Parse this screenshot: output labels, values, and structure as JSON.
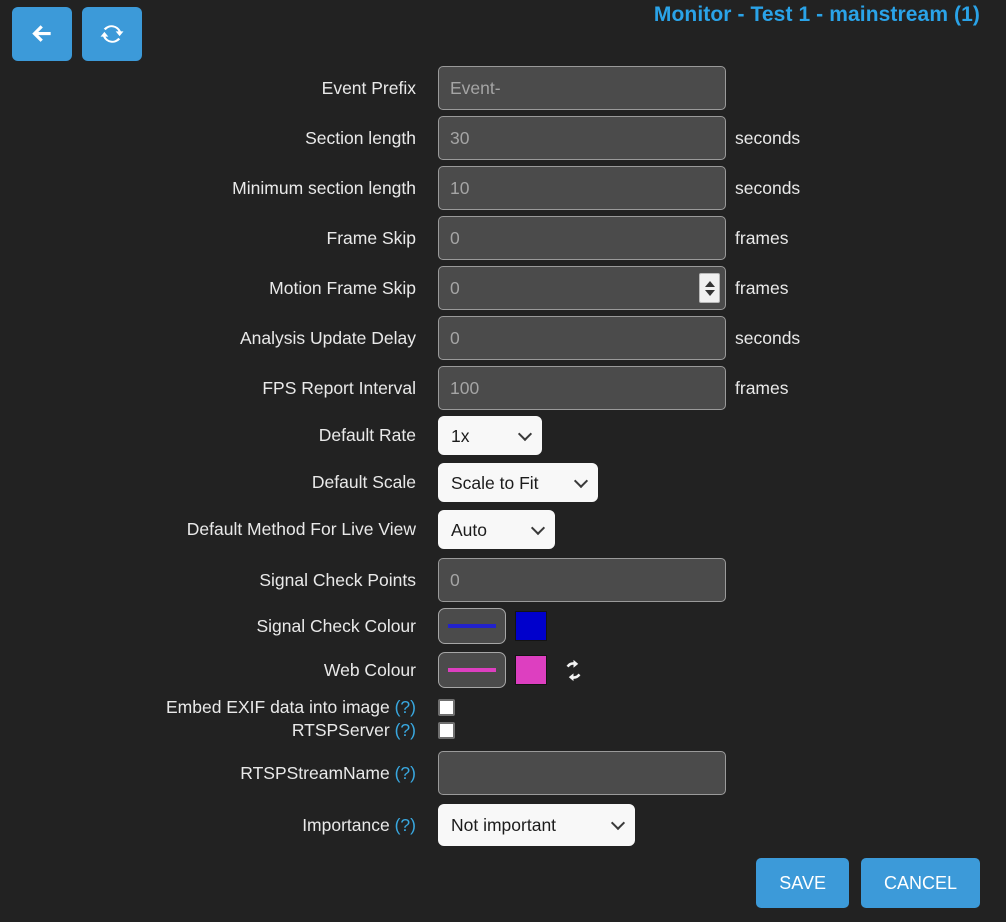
{
  "header": {
    "title": "Monitor - Test 1 - mainstream (1)",
    "back_icon": "arrow-left-icon",
    "refresh_icon": "refresh-icon",
    "accent_color": "#2aa3e8",
    "button_color": "#3c9ad9"
  },
  "fields": {
    "event_prefix": {
      "label": "Event Prefix",
      "value": "",
      "placeholder": "Event-",
      "unit": ""
    },
    "section_length": {
      "label": "Section length",
      "value": "",
      "placeholder": "30",
      "unit": "seconds"
    },
    "minimum_section_length": {
      "label": "Minimum section length",
      "value": "",
      "placeholder": "10",
      "unit": "seconds"
    },
    "frame_skip": {
      "label": "Frame Skip",
      "value": "",
      "placeholder": "0",
      "unit": "frames"
    },
    "motion_frame_skip": {
      "label": "Motion Frame Skip",
      "value": "",
      "placeholder": "0",
      "unit": "frames"
    },
    "analysis_update_delay": {
      "label": "Analysis Update Delay",
      "value": "",
      "placeholder": "0",
      "unit": "seconds"
    },
    "fps_report_interval": {
      "label": "FPS Report Interval",
      "value": "",
      "placeholder": "100",
      "unit": "frames"
    },
    "default_rate": {
      "label": "Default Rate",
      "selected": "1x",
      "options": [
        "1x"
      ]
    },
    "default_scale": {
      "label": "Default Scale",
      "selected": "Scale to Fit",
      "options": [
        "Scale to Fit"
      ]
    },
    "default_method_live_view": {
      "label": "Default Method For Live View",
      "selected": "Auto",
      "options": [
        "Auto"
      ]
    },
    "signal_check_points": {
      "label": "Signal Check Points",
      "value": "",
      "placeholder": "0",
      "unit": ""
    },
    "signal_check_colour": {
      "label": "Signal Check Colour",
      "color": "#0000cc",
      "swatch": "#0000cc"
    },
    "web_colour": {
      "label": "Web Colour",
      "color": "#dd3fc0",
      "swatch": "#dd3fc0",
      "cycle_icon": "refresh-icon"
    },
    "embed_exif": {
      "label": "Embed EXIF data into image",
      "help": "(?)",
      "checked": false
    },
    "rtsp_server": {
      "label": "RTSPServer",
      "help": "(?)",
      "checked": false
    },
    "rtsp_stream_name": {
      "label": "RTSPStreamName",
      "help": "(?)",
      "value": "",
      "placeholder": ""
    },
    "importance": {
      "label": "Importance",
      "help": "(?)",
      "selected": "Not important",
      "options": [
        "Not important"
      ]
    }
  },
  "actions": {
    "save_label": "SAVE",
    "cancel_label": "CANCEL"
  }
}
